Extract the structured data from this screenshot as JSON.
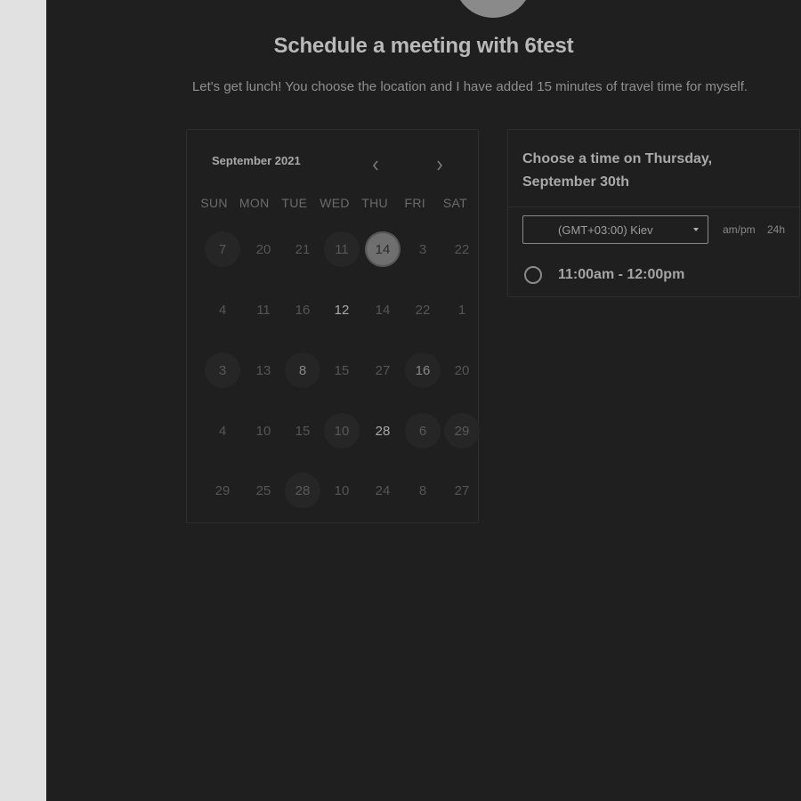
{
  "header": {
    "title": "Schedule a meeting with 6test",
    "description": "Let's get lunch! You choose the location and I have added 15 minutes of travel time for myself."
  },
  "calendar": {
    "month_label": "September 2021",
    "prev_icon": "chevron-left-icon",
    "next_icon": "chevron-right-icon",
    "weekdays": [
      "SUN",
      "MON",
      "TUE",
      "WED",
      "THU",
      "FRI",
      "SAT"
    ],
    "rows": [
      [
        "7",
        "20",
        "21",
        "11",
        "14",
        "3",
        "22"
      ],
      [
        "4",
        "11",
        "16",
        "12",
        "14",
        "22",
        "1"
      ],
      [
        "3",
        "13",
        "8",
        "15",
        "27",
        "16",
        "20"
      ],
      [
        "4",
        "10",
        "15",
        "10",
        "28",
        "6",
        "29"
      ],
      [
        "29",
        "25",
        "28",
        "10",
        "24",
        "8",
        "27"
      ]
    ],
    "selected_day": "14"
  },
  "time_panel": {
    "heading": "Choose a time on Thursday, September 30th",
    "timezone": "(GMT+03:00) Kiev",
    "format_options": [
      "am/pm",
      "24h"
    ],
    "slots": [
      "11:00am - 12:00pm"
    ]
  },
  "colors": {
    "background": "#1f1f1f",
    "left_strip": "#e1e1e1",
    "panel_border": "#2e2e2e",
    "selected_day": "#6f6f6f"
  }
}
